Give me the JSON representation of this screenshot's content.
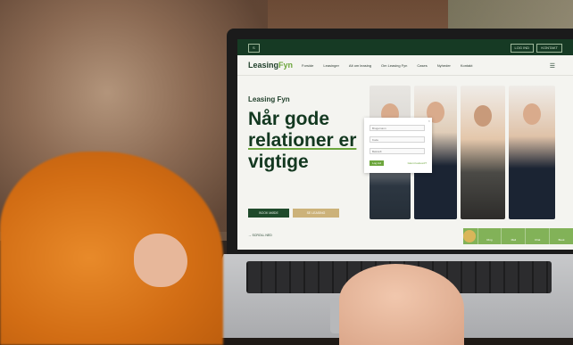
{
  "site": {
    "topbar": {
      "chip_left": "S",
      "chip_right_1": "LOG IND",
      "chip_right_2": "KONTAKT"
    },
    "logo": {
      "main": "Leasing",
      "accent": "Fyn"
    },
    "nav": [
      "Forside",
      "Leasinger",
      "Alt om leasing",
      "Om Leasing Fyn",
      "Cases",
      "Nyheder",
      "Kontakt"
    ],
    "hero": {
      "label": "Leasing Fyn",
      "title_line1": "Når gode",
      "title_line2": "relationer er",
      "title_line3": "vigtige",
      "btn_primary": "BOOK MØDE",
      "btn_secondary": "SE LEASING",
      "scroll_hint": "SCROLL NED"
    },
    "login_modal": {
      "field1_placeholder": "Brugernavn",
      "field2_placeholder": "Kode",
      "field3_placeholder": "Bekræft",
      "login_button": "Log ind",
      "forgot_link": "Glemt kodeord?",
      "close": "×"
    },
    "floating_bar": [
      "Ring",
      "Mail",
      "Chat",
      "Book"
    ]
  }
}
